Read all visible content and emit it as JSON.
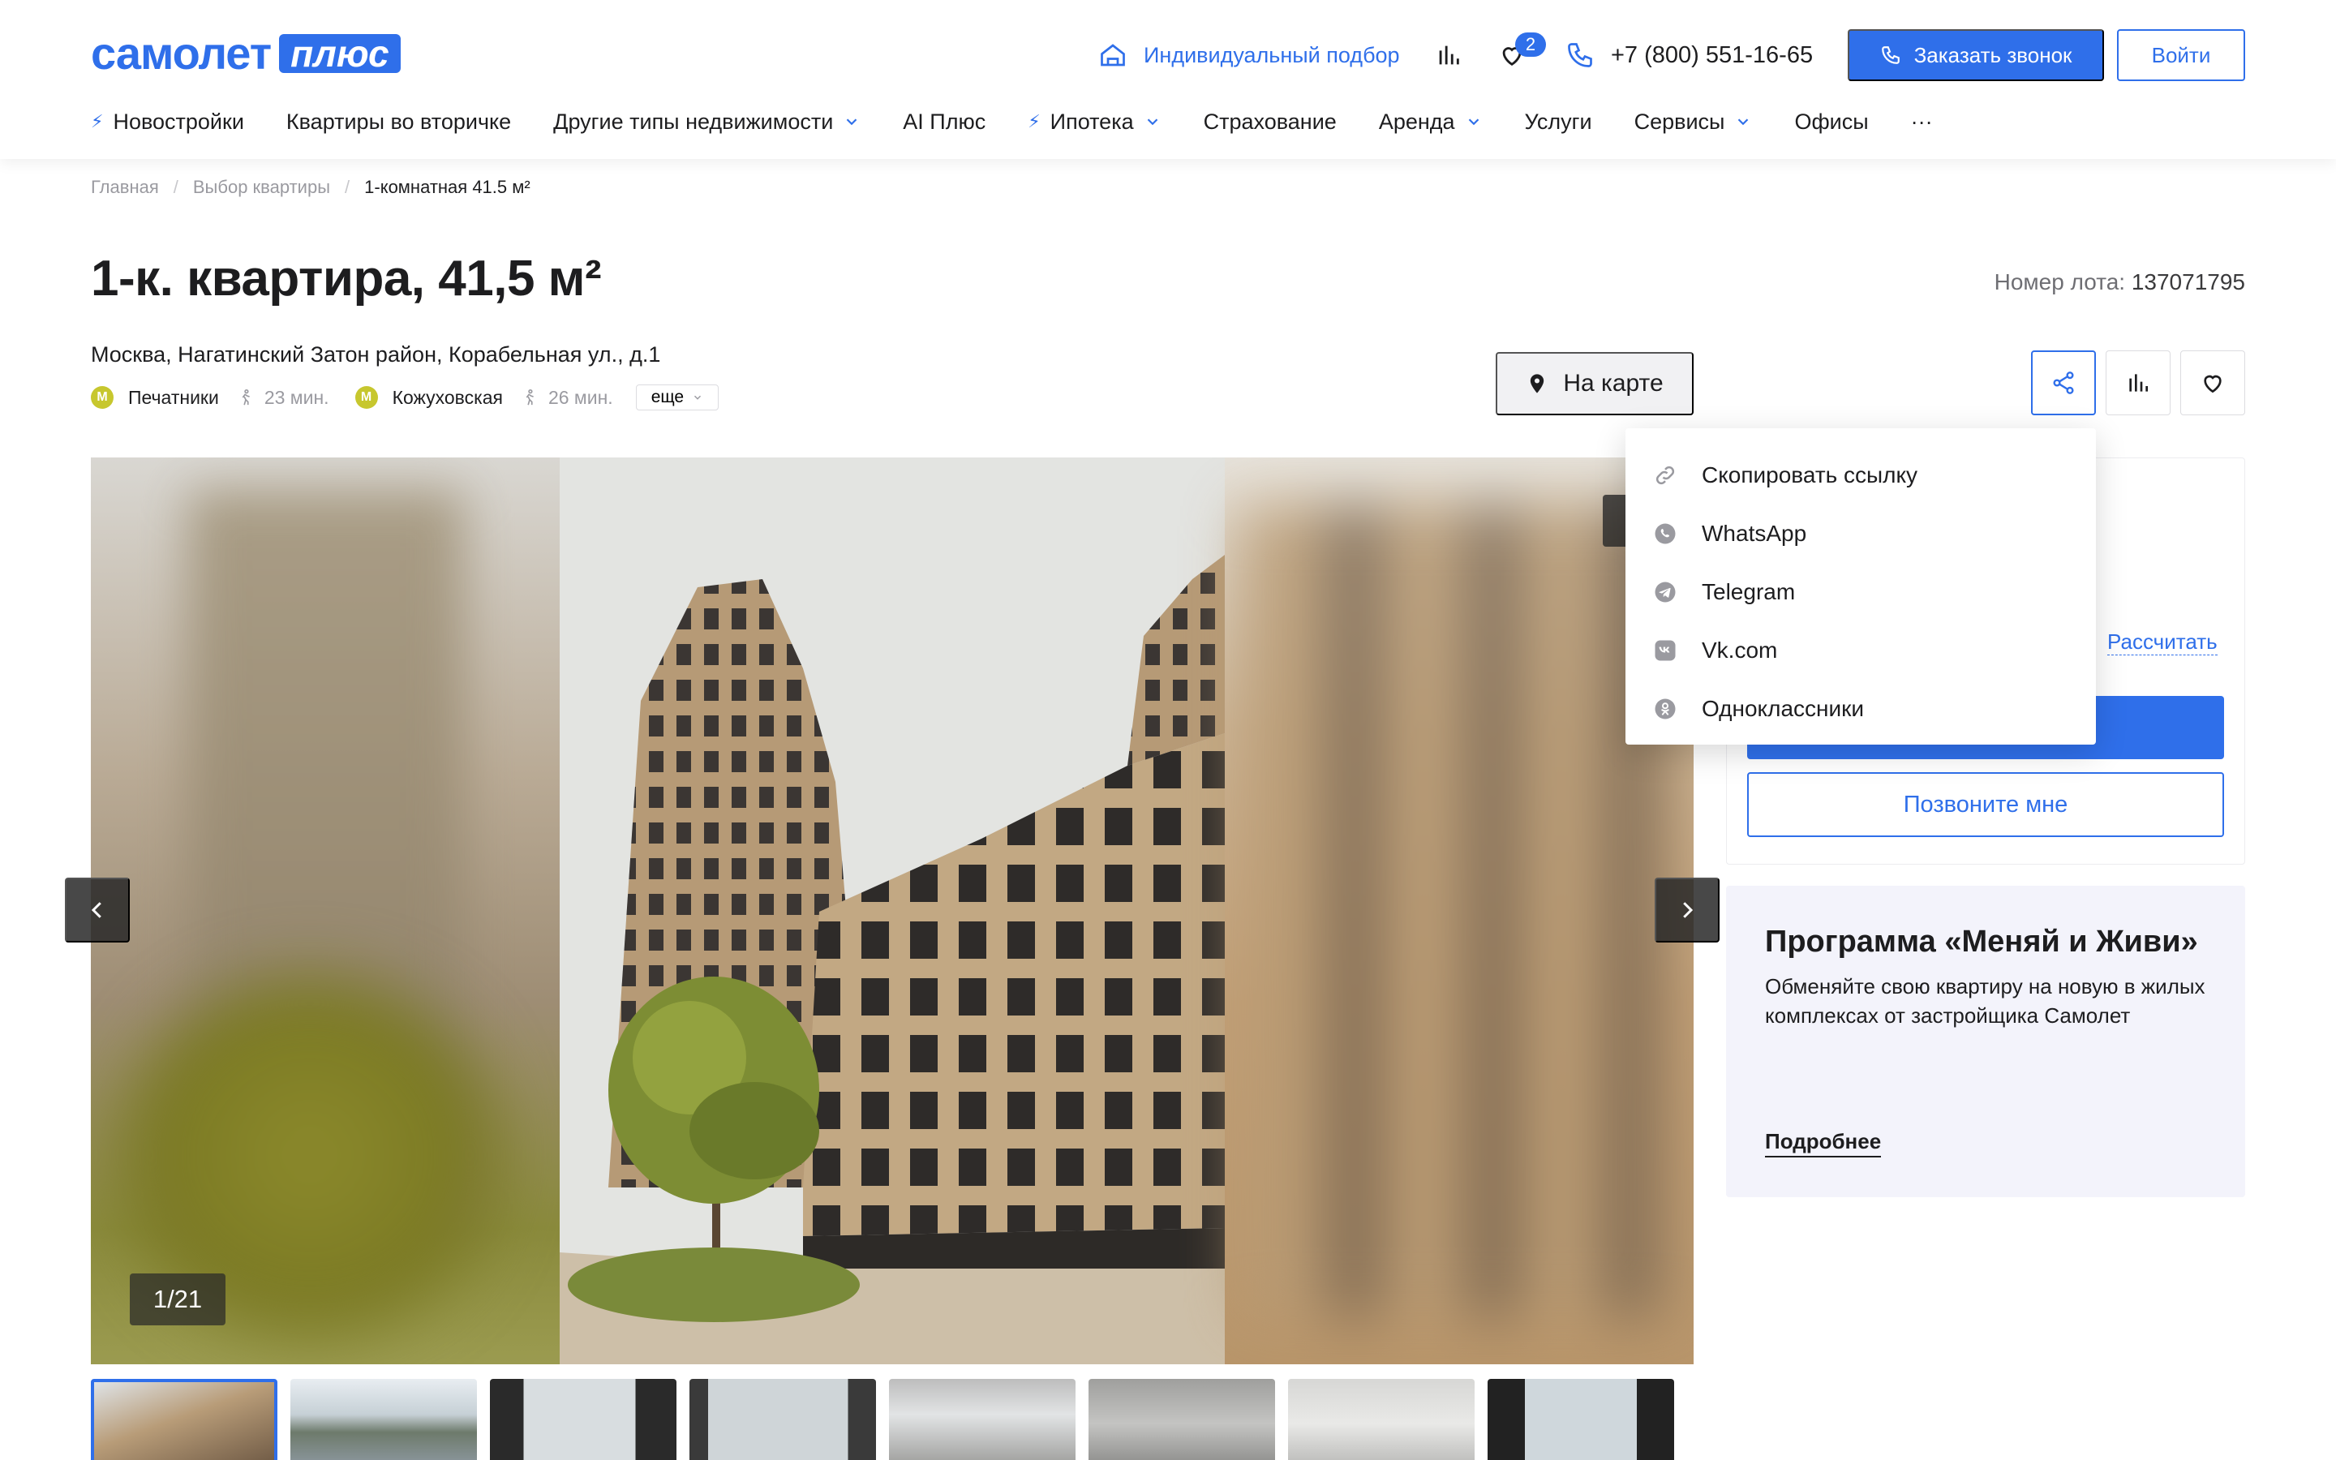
{
  "header": {
    "logo_text": "самолет",
    "logo_badge": "плюс",
    "selection_label": "Индивидуальный подбор",
    "favorites_count": "2",
    "phone": "+7 (800) 551-16-65",
    "call_button": "Заказать звонок",
    "login_button": "Войти"
  },
  "nav": {
    "items": [
      {
        "label": "Новостройки"
      },
      {
        "label": "Квартиры во вторичке"
      },
      {
        "label": "Другие типы недвижимости"
      },
      {
        "label": "AI Плюс"
      },
      {
        "label": "Ипотека"
      },
      {
        "label": "Страхование"
      },
      {
        "label": "Аренда"
      },
      {
        "label": "Услуги"
      },
      {
        "label": "Сервисы"
      },
      {
        "label": "Офисы"
      },
      {
        "label": "···"
      }
    ]
  },
  "breadcrumb": [
    "Главная",
    "Выбор квартиры",
    "1-комнатная 41.5 м²"
  ],
  "listing": {
    "title": "1-к. квартира, 41,5 м²",
    "lot_label": "Номер лота:",
    "lot_number": "137071795",
    "address": "Москва, Нагатинский Затон район, Корабельная ул., д.1",
    "metro": [
      {
        "badge": "М",
        "station": "Печатники",
        "walk": "23 мин."
      },
      {
        "badge": "М",
        "station": "Кожуховская",
        "walk": "26 мин."
      }
    ],
    "more_label": "еще",
    "map_button": "На карте"
  },
  "gallery": {
    "counter": "1/21",
    "thumbnails_count": 8
  },
  "share_menu": {
    "items": [
      {
        "label": "Скопировать ссылку",
        "icon": "link-icon"
      },
      {
        "label": "WhatsApp",
        "icon": "whatsapp-icon"
      },
      {
        "label": "Telegram",
        "icon": "telegram-icon"
      },
      {
        "label": "Vk.com",
        "icon": "vk-icon"
      },
      {
        "label": "Одноклассники",
        "icon": "odnoklassniki-icon"
      }
    ]
  },
  "sidebar": {
    "calc_link": "Рассчитать",
    "call_me_button": "Позвоните мне"
  },
  "promo": {
    "title": "Программа «Меняй и Живи»",
    "text": "Обменяйте свою квартиру на новую в жилых комплексах от застройщика Самолет",
    "link": "Подробнее"
  },
  "colors": {
    "accent": "#2f6fea",
    "metro": "#c7c72e",
    "promo_bg": "#f3f3fb"
  }
}
